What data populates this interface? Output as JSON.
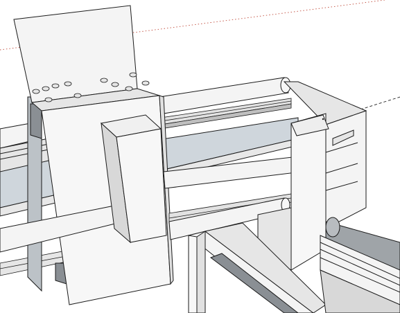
{
  "scene": {
    "description_free": true,
    "viewport": "3d-model-view",
    "colors": {
      "background": "#ffffff",
      "face_light": "#f7f7f7",
      "face_mid": "#e4e4e4",
      "face_shade": "#cfd6dc",
      "face_dark": "#9fa4a8",
      "edge": "#1a1a1a",
      "axis_red": "#c04a3a",
      "axis_black": "#202020"
    },
    "components": [
      "top-plate",
      "carriage-block",
      "linear-rails",
      "round-rods",
      "end-bracket",
      "frame-rails",
      "ball-screw"
    ]
  }
}
